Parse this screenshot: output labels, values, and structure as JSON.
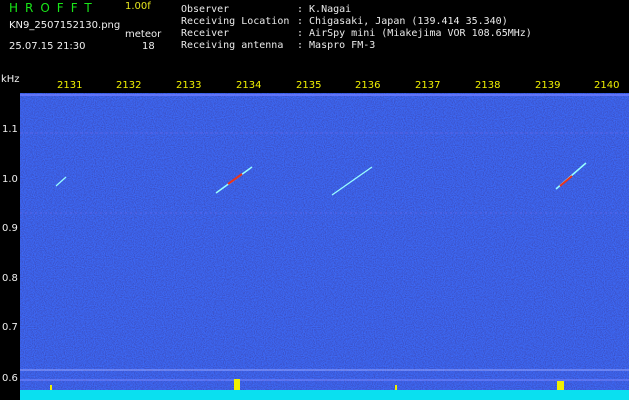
{
  "header": {
    "logo": "HROFFT",
    "version": "1.00f",
    "filename": "KN9_2507152130.png",
    "datetime": "25.07.15 21:30",
    "meteor_label": "meteor",
    "meteor_count": "18",
    "info": [
      {
        "label": "Observer",
        "value": ": K.Nagai"
      },
      {
        "label": "Receiving Location",
        "value": ": Chigasaki, Japan (139.414 35.340)"
      },
      {
        "label": "Receiver",
        "value": ": AirSpy mini (Miakejima VOR 108.65MHz)"
      },
      {
        "label": "Receiving antenna",
        "value": ": Maspro FM-3"
      }
    ]
  },
  "axis": {
    "unit": "kHz",
    "time_ticks": [
      "2131",
      "2132",
      "2133",
      "2134",
      "2135",
      "2136",
      "2137",
      "2138",
      "2139",
      "2140"
    ],
    "freq_ticks": [
      "1.1",
      "1.0",
      "0.9",
      "0.8",
      "0.7",
      "0.6"
    ]
  },
  "colors": {
    "background": "#000000",
    "waterfall_base": "#0a1a8c",
    "signal_line": "#9aa6ff",
    "meteor_hot": "#e8341c",
    "bottom_band": "#0ae0f0",
    "spike": "#f0f000"
  }
}
